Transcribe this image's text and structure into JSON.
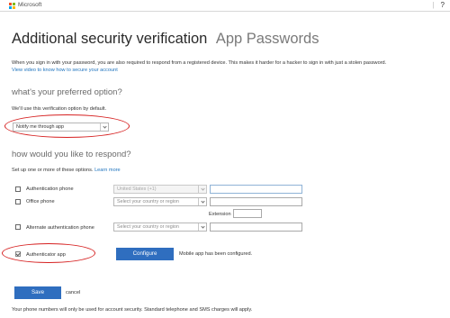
{
  "topbar": {
    "brand": "Microsoft",
    "separator": "|",
    "help": "?"
  },
  "colors": {
    "ms_red": "#f25022",
    "ms_green": "#7fba00",
    "ms_blue": "#00a4ef",
    "ms_yellow": "#ffb900",
    "accent": "#2f6ebf",
    "annotation": "#d62020"
  },
  "heading": {
    "title": "Additional security verification",
    "tab": "App Passwords"
  },
  "intro": {
    "text": "When you sign in with your password, you are also required to respond from a registered device. This makes it harder for a hacker to sign in with just a stolen password.",
    "video_link": "View video to know how to secure your account"
  },
  "preferred": {
    "title": "what's your preferred option?",
    "note": "We'll use this verification option by default.",
    "selected": "Notify me through app"
  },
  "respond": {
    "title": "how would you like to respond?",
    "note": "Set up one or more of these options.",
    "learn_more": "Learn more",
    "auth_phone_label": "Authentication phone",
    "auth_phone_country": "United States (+1)",
    "office_phone_label": "Office phone",
    "office_phone_country": "Select your country or region",
    "extension_label": "Extension",
    "alt_phone_label": "Alternate authentication phone",
    "alt_phone_country": "Select your country or region",
    "app_label": "Authenticator app",
    "configure_label": "Configure",
    "app_status": "Mobile app has been configured."
  },
  "actions": {
    "save": "Save",
    "cancel": "cancel"
  },
  "footer": {
    "note": "Your phone numbers will only be used for account security. Standard telephone and SMS charges will apply."
  }
}
